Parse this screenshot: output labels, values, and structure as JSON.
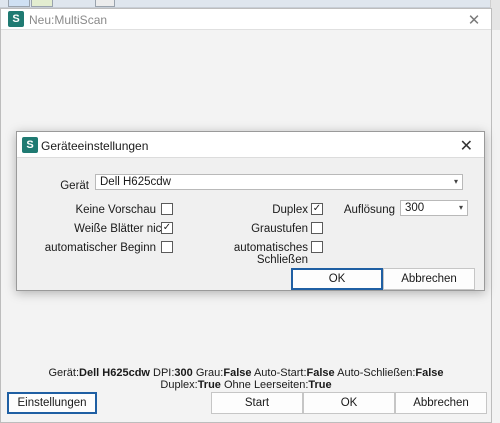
{
  "main_window": {
    "title": "Neu:MultiScan",
    "close_glyph": "✕",
    "logo_letter": "S"
  },
  "status": {
    "line1": [
      {
        "k": "Gerät:",
        "v": "Dell H625cdw"
      },
      {
        "k": " DPI:",
        "v": "300"
      },
      {
        "k": " Grau:",
        "v": "False"
      },
      {
        "k": " Auto-Start:",
        "v": "False"
      },
      {
        "k": " Auto-Schließen:",
        "v": "False"
      }
    ],
    "line2": [
      {
        "k": "Duplex:",
        "v": "True"
      },
      {
        "k": " Ohne Leerseiten:",
        "v": "True"
      }
    ]
  },
  "footer": {
    "settings_label": "Einstellungen",
    "start_label": "Start",
    "ok_label": "OK",
    "cancel_label": "Abbrechen"
  },
  "dialog": {
    "title": "Geräteeinstellungen",
    "logo_letter": "S",
    "close_glyph": "✕",
    "device_label": "Gerät",
    "device_value": "Dell H625cdw",
    "no_preview_label": "Keine Vorschau",
    "no_preview_checked": false,
    "white_pages_label": "Weiße Blätter nicht",
    "white_pages_checked": true,
    "auto_start_label": "automatischer Beginn",
    "auto_start_checked": false,
    "duplex_label": "Duplex",
    "duplex_checked": true,
    "grayscale_label": "Graustufen",
    "grayscale_checked": false,
    "auto_close_label": "automatisches Schließen",
    "auto_close_checked": false,
    "resolution_label": "Auflösung",
    "resolution_value": "300",
    "ok_label": "OK",
    "cancel_label": "Abbrechen",
    "check_glyph": "✓",
    "dropdown_glyph": "▾"
  },
  "colors": {
    "logo_bg": "#1f7a72",
    "primary_border": "#1f5fa3"
  }
}
